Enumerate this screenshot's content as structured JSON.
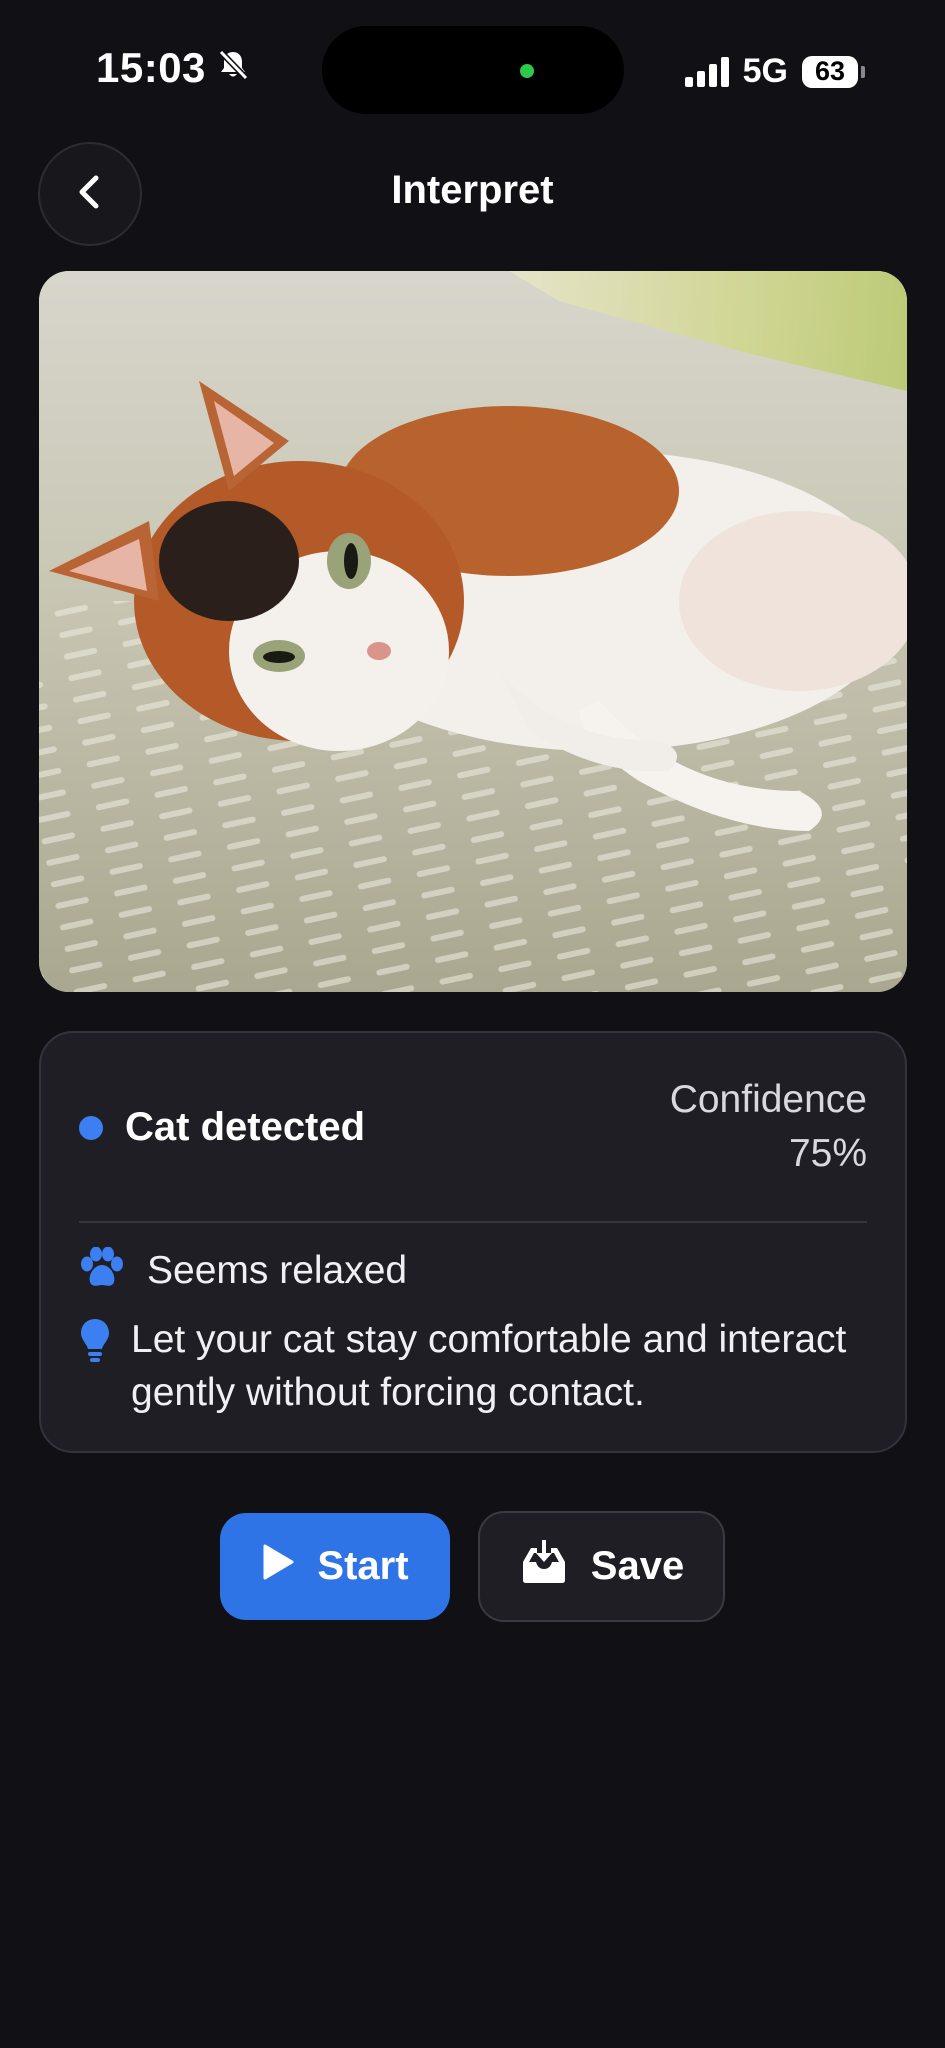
{
  "status_bar": {
    "time": "15:03",
    "network": "5G",
    "battery": "63",
    "icons": [
      "bell-slash-icon",
      "signal-icon",
      "battery-icon"
    ]
  },
  "nav": {
    "title": "Interpret",
    "back_icon": "chevron-left-icon"
  },
  "photo": {
    "subject_icon": "cat-photo"
  },
  "result": {
    "detected_label": "Cat detected",
    "confidence_label": "Confidence",
    "confidence_value": "75%",
    "mood": "Seems relaxed",
    "tip": "Let your cat stay comfortable and interact gently without forcing contact."
  },
  "actions": {
    "start_label": "Start",
    "save_label": "Save"
  },
  "colors": {
    "background": "#101015",
    "card": "#1e1e24",
    "accent": "#2f74e6"
  }
}
